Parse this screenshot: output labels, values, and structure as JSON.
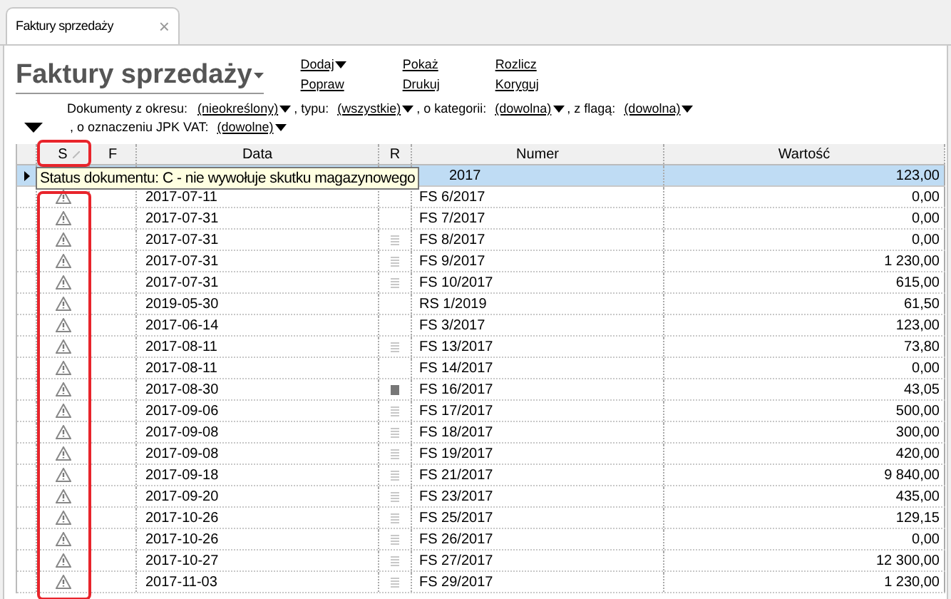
{
  "tab": {
    "label": "Faktury sprzedaży",
    "selected": true,
    "close": "×"
  },
  "title": {
    "text": "Faktury sprzedaży",
    "dropdown": true
  },
  "actions": [
    {
      "label": "Dodaj",
      "dropdown": true
    },
    {
      "label": "Popraw",
      "dropdown": false
    },
    {
      "label": "Pokaż",
      "dropdown": false
    },
    {
      "label": "Drukuj",
      "dropdown": false
    },
    {
      "label": "Rozlicz",
      "dropdown": false
    },
    {
      "label": "Koryguj",
      "dropdown": false
    }
  ],
  "filters": [
    {
      "label": "Dokumenty z okresu:",
      "value": "(nieokreślony)"
    },
    {
      "label": ", typu:",
      "value": "(wszystkie)"
    },
    {
      "label": ", o kategorii:",
      "value": "(dowolna)"
    },
    {
      "label": ", z flagą:",
      "value": "(dowolna)"
    },
    {
      "label": ", o oznaczeniu JPK VAT:",
      "value": "(dowolne)"
    }
  ],
  "filters_expanded": true,
  "table": {
    "columns": [
      {
        "label": "S",
        "sorted": true
      },
      {
        "label": "F",
        "sorted": false
      },
      {
        "label": "Data",
        "sorted": false
      },
      {
        "label": "R",
        "sorted": false
      },
      {
        "label": "Numer",
        "sorted": false
      },
      {
        "label": "Wartość",
        "sorted": false
      }
    ],
    "rows": [
      {
        "selected": true,
        "covered": true,
        "numer": "2017",
        "value": "123,00"
      },
      {
        "selected": false,
        "covered": false,
        "warning": true,
        "note": false,
        "date": "2017-07-11",
        "numer": "FS 6/2017",
        "value": "0,00"
      },
      {
        "selected": false,
        "covered": false,
        "warning": true,
        "note": false,
        "date": "2017-07-31",
        "numer": "FS 7/2017",
        "value": "0,00"
      },
      {
        "selected": false,
        "covered": false,
        "warning": true,
        "note": true,
        "note_dark": false,
        "date": "2017-07-31",
        "numer": "FS 8/2017",
        "value": "0,00"
      },
      {
        "selected": false,
        "covered": false,
        "warning": true,
        "note": true,
        "note_dark": false,
        "date": "2017-07-31",
        "numer": "FS 9/2017",
        "value": "1 230,00"
      },
      {
        "selected": false,
        "covered": false,
        "warning": true,
        "note": true,
        "note_dark": false,
        "date": "2017-07-31",
        "numer": "FS 10/2017",
        "value": "615,00"
      },
      {
        "selected": false,
        "covered": false,
        "warning": true,
        "note": false,
        "date": "2019-05-30",
        "numer": "RS 1/2019",
        "value": "61,50"
      },
      {
        "selected": false,
        "covered": false,
        "warning": true,
        "note": false,
        "date": "2017-06-14",
        "numer": "FS 3/2017",
        "value": "123,00"
      },
      {
        "selected": false,
        "covered": false,
        "warning": true,
        "note": true,
        "note_dark": false,
        "date": "2017-08-11",
        "numer": "FS 13/2017",
        "value": "73,80"
      },
      {
        "selected": false,
        "covered": false,
        "warning": true,
        "note": false,
        "date": "2017-08-11",
        "numer": "FS 14/2017",
        "value": "0,00"
      },
      {
        "selected": false,
        "covered": false,
        "warning": true,
        "note": true,
        "note_dark": true,
        "date": "2017-08-30",
        "numer": "FS 16/2017",
        "value": "43,05"
      },
      {
        "selected": false,
        "covered": false,
        "warning": true,
        "note": true,
        "note_dark": false,
        "date": "2017-09-06",
        "numer": "FS 17/2017",
        "value": "500,00"
      },
      {
        "selected": false,
        "covered": false,
        "warning": true,
        "note": true,
        "note_dark": false,
        "date": "2017-09-08",
        "numer": "FS 18/2017",
        "value": "300,00"
      },
      {
        "selected": false,
        "covered": false,
        "warning": true,
        "note": true,
        "note_dark": false,
        "date": "2017-09-08",
        "numer": "FS 19/2017",
        "value": "420,00"
      },
      {
        "selected": false,
        "covered": false,
        "warning": true,
        "note": true,
        "note_dark": false,
        "date": "2017-09-18",
        "numer": "FS 21/2017",
        "value": "9 840,00"
      },
      {
        "selected": false,
        "covered": false,
        "warning": true,
        "note": true,
        "note_dark": false,
        "date": "2017-09-20",
        "numer": "FS 23/2017",
        "value": "435,00"
      },
      {
        "selected": false,
        "covered": false,
        "warning": true,
        "note": true,
        "note_dark": false,
        "date": "2017-10-26",
        "numer": "FS 25/2017",
        "value": "129,15"
      },
      {
        "selected": false,
        "covered": false,
        "warning": true,
        "note": true,
        "note_dark": false,
        "date": "2017-10-26",
        "numer": "FS 26/2017",
        "value": "0,00"
      },
      {
        "selected": false,
        "covered": false,
        "warning": true,
        "note": true,
        "note_dark": false,
        "date": "2017-10-27",
        "numer": "FS 27/2017",
        "value": "12 300,00"
      },
      {
        "selected": false,
        "covered": false,
        "warning": true,
        "note": true,
        "note_dark": false,
        "date": "2017-11-03",
        "numer": "FS 29/2017",
        "value": "1 230,00"
      }
    ]
  },
  "tooltip": {
    "text": "Status dokumentu: C - nie wywołuje skutku magazynowego"
  },
  "highlight": {
    "on": true
  }
}
